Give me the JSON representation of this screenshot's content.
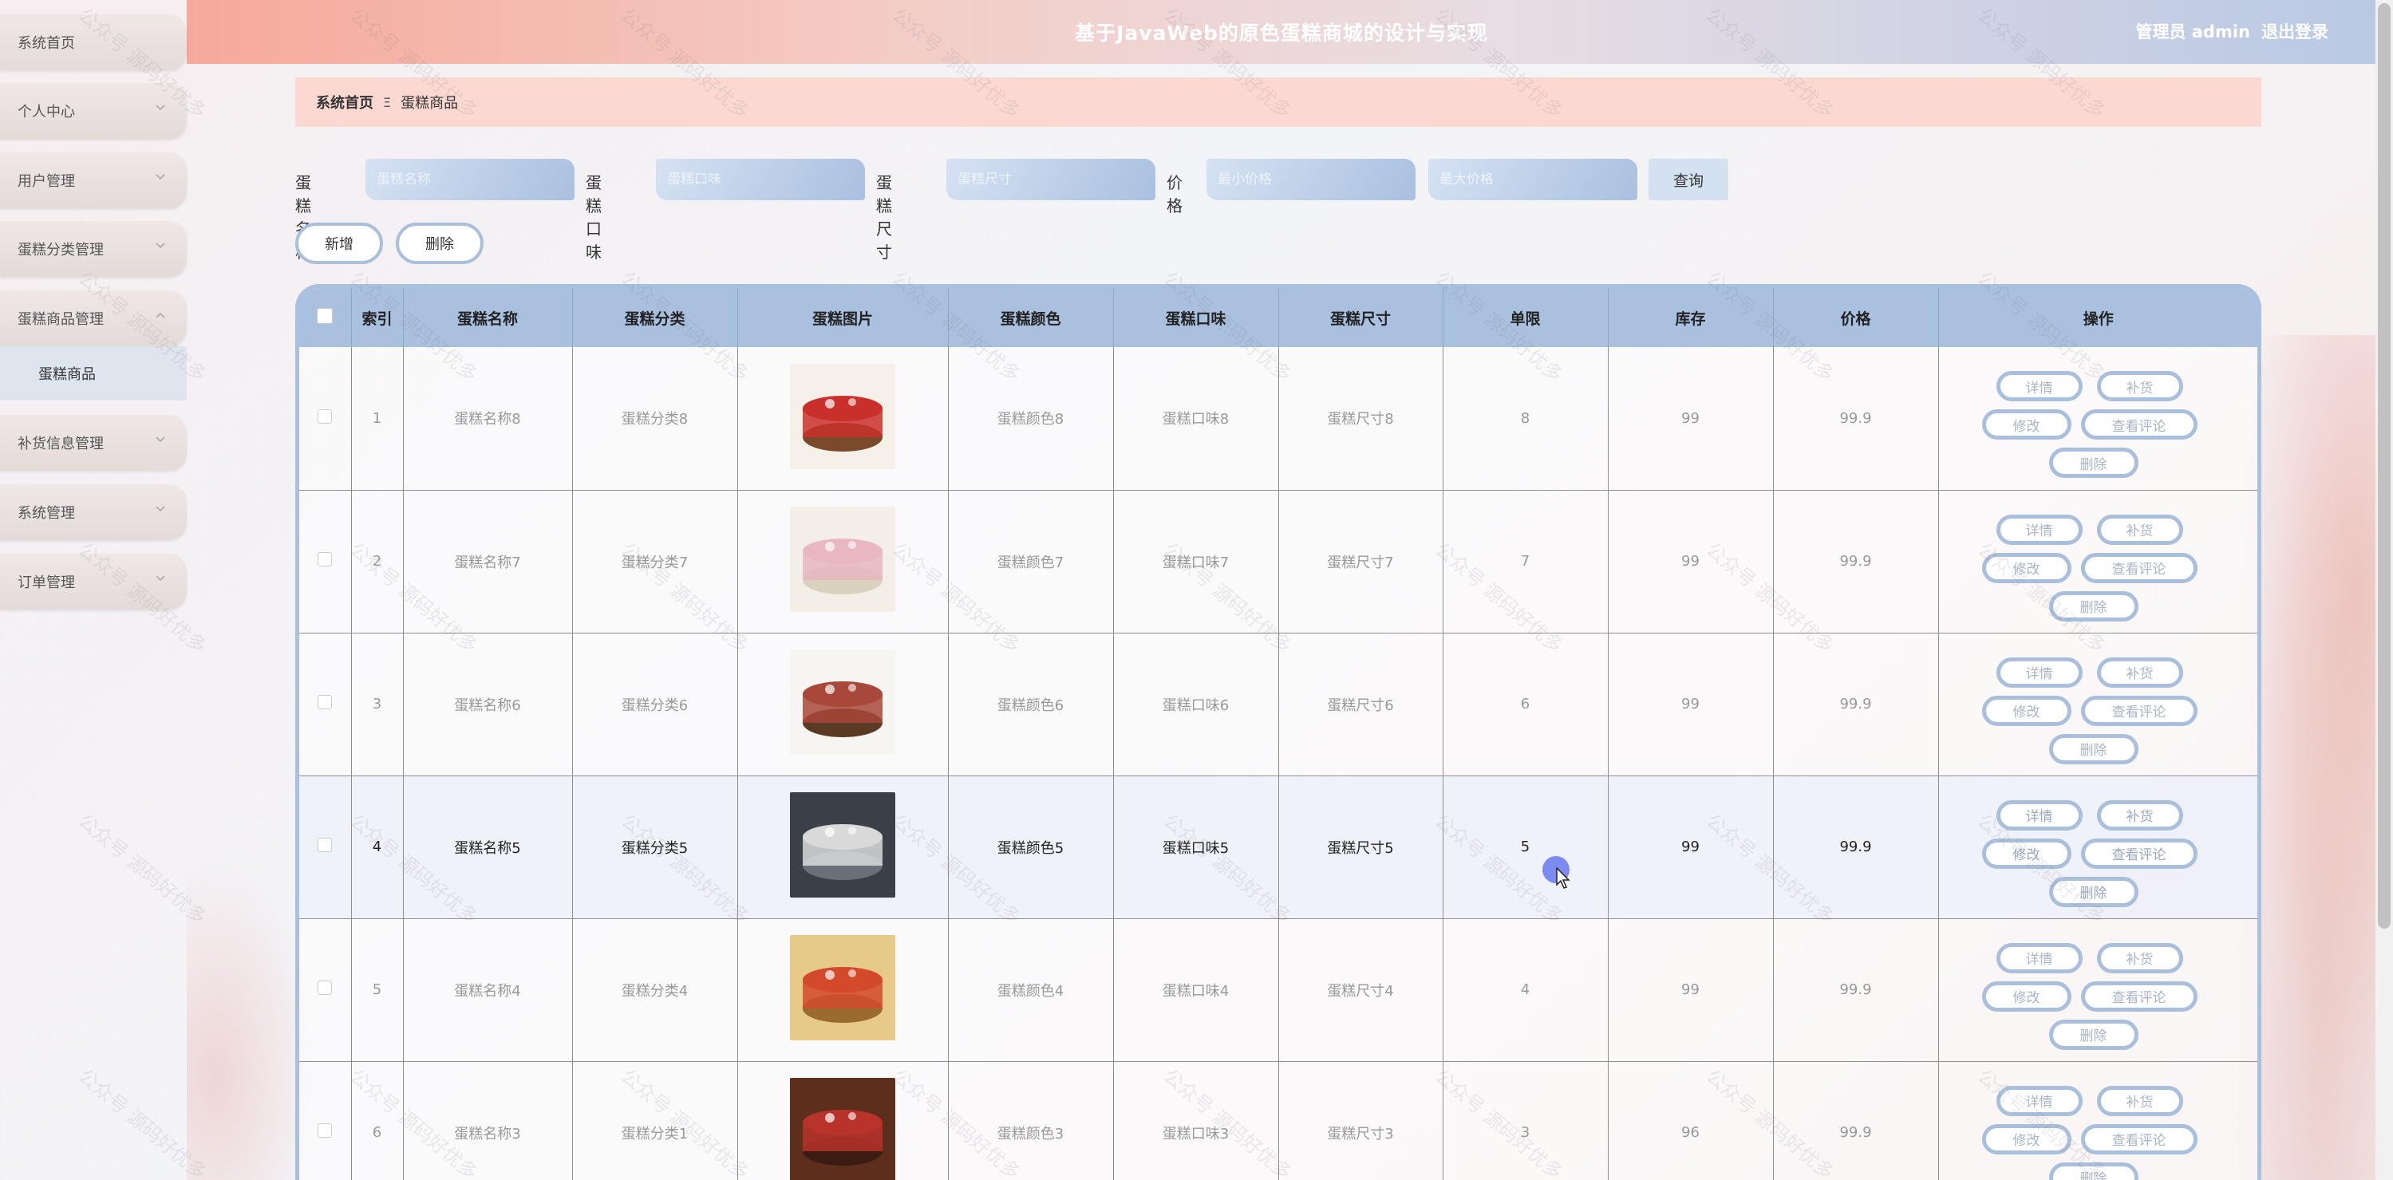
{
  "header": {
    "title": "基于JavaWeb的原色蛋糕商城的设计与实现",
    "admin_label": "管理员 admin",
    "logout_label": "退出登录"
  },
  "sidebar": {
    "items": [
      {
        "label": "系统首页"
      },
      {
        "label": "个人中心"
      },
      {
        "label": "用户管理"
      },
      {
        "label": "蛋糕分类管理"
      },
      {
        "label": "蛋糕商品管理"
      },
      {
        "label": "补货信息管理"
      },
      {
        "label": "系统管理"
      },
      {
        "label": "订单管理"
      }
    ],
    "sub_item": "蛋糕商品"
  },
  "breadcrumb": {
    "home": "系统首页",
    "separator": "Ξ",
    "current": "蛋糕商品"
  },
  "search": {
    "name_label": "蛋糕名称",
    "name_placeholder": "蛋糕名称",
    "flavor_label": "蛋糕口味",
    "flavor_placeholder": "蛋糕口味",
    "size_label": "蛋糕尺寸",
    "size_placeholder": "蛋糕尺寸",
    "price_label": "价格",
    "min_placeholder": "最小价格",
    "max_placeholder": "最大价格",
    "query_label": "查询"
  },
  "actions": {
    "add_label": "新增",
    "delete_label": "删除"
  },
  "table": {
    "headers": [
      "索引",
      "蛋糕名称",
      "蛋糕分类",
      "蛋糕图片",
      "蛋糕颜色",
      "蛋糕口味",
      "蛋糕尺寸",
      "单限",
      "库存",
      "价格",
      "操作"
    ],
    "rows": [
      {
        "index": "1",
        "name": "蛋糕名称8",
        "category": "蛋糕分类8",
        "color": "蛋糕颜色8",
        "flavor": "蛋糕口味8",
        "size": "蛋糕尺寸8",
        "limit": "8",
        "stock": "99",
        "price": "99.9"
      },
      {
        "index": "2",
        "name": "蛋糕名称7",
        "category": "蛋糕分类7",
        "color": "蛋糕颜色7",
        "flavor": "蛋糕口味7",
        "size": "蛋糕尺寸7",
        "limit": "7",
        "stock": "99",
        "price": "99.9"
      },
      {
        "index": "3",
        "name": "蛋糕名称6",
        "category": "蛋糕分类6",
        "color": "蛋糕颜色6",
        "flavor": "蛋糕口味6",
        "size": "蛋糕尺寸6",
        "limit": "6",
        "stock": "99",
        "price": "99.9"
      },
      {
        "index": "4",
        "name": "蛋糕名称5",
        "category": "蛋糕分类5",
        "color": "蛋糕颜色5",
        "flavor": "蛋糕口味5",
        "size": "蛋糕尺寸5",
        "limit": "5",
        "stock": "99",
        "price": "99.9"
      },
      {
        "index": "5",
        "name": "蛋糕名称4",
        "category": "蛋糕分类4",
        "color": "蛋糕颜色4",
        "flavor": "蛋糕口味4",
        "size": "蛋糕尺寸4",
        "limit": "4",
        "stock": "99",
        "price": "99.9"
      },
      {
        "index": "6",
        "name": "蛋糕名称3",
        "category": "蛋糕分类1",
        "color": "蛋糕颜色3",
        "flavor": "蛋糕口味3",
        "size": "蛋糕尺寸3",
        "limit": "3",
        "stock": "96",
        "price": "99.9"
      }
    ],
    "ops": {
      "detail": "详情",
      "restock": "补货",
      "edit": "修改",
      "reviews": "查看评论",
      "delete": "删除"
    }
  },
  "colors": {
    "accent": "#a9c0df",
    "breadcrumb_bg": "#fbd9d2",
    "header_left": "#f6a99a",
    "cursor": "#6f7ff0"
  },
  "watermark": "公众号 源码好优多"
}
